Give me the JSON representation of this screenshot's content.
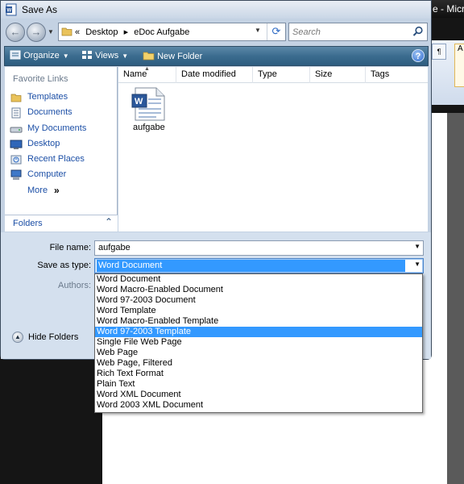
{
  "background_window": {
    "title_fragment": "e - Micro",
    "close_glyph": "X"
  },
  "dialog": {
    "title": "Save As"
  },
  "navigation": {
    "back_glyph": "←",
    "forward_glyph": "→",
    "address_prefix": "«",
    "breadcrumb": [
      "Desktop",
      "eDoc Aufgabe"
    ],
    "breadcrumb_separator": "▸",
    "search_placeholder": "Search"
  },
  "toolbar": {
    "organize_label": "Organize",
    "views_label": "Views",
    "new_folder_label": "New Folder",
    "help_glyph": "?"
  },
  "favorite_links": {
    "heading": "Favorite Links",
    "items": [
      {
        "label": "Templates",
        "icon": "folder-icon"
      },
      {
        "label": "Documents",
        "icon": "documents-icon"
      },
      {
        "label": "My Documents",
        "icon": "drive-icon"
      },
      {
        "label": "Desktop",
        "icon": "desktop-icon"
      },
      {
        "label": "Recent Places",
        "icon": "recent-places-icon"
      },
      {
        "label": "Computer",
        "icon": "computer-icon"
      },
      {
        "label": "More",
        "icon": "more-chevron-icon",
        "suffix": "»"
      }
    ],
    "folders_label": "Folders",
    "folders_chevron": "⌃"
  },
  "file_list": {
    "columns": [
      "Name",
      "Date modified",
      "Type",
      "Size",
      "Tags"
    ],
    "sort_arrow": "▲",
    "files": [
      {
        "name": "aufgabe",
        "icon": "word-document-icon"
      }
    ]
  },
  "form": {
    "file_name_label": "File name:",
    "file_name_value": "aufgabe",
    "save_as_type_label": "Save as type:",
    "save_as_type_value": "Word Document",
    "authors_label": "Authors:",
    "hide_folders_label": "Hide Folders"
  },
  "save_type_options": [
    "Word Document",
    "Word Macro-Enabled Document",
    "Word 97-2003 Document",
    "Word Template",
    "Word Macro-Enabled Template",
    "Word 97-2003 Template",
    "Single File Web Page",
    "Web Page",
    "Web Page, Filtered",
    "Rich Text Format",
    "Plain Text",
    "Word XML Document",
    "Word 2003 XML Document"
  ],
  "highlighted_option_index": 5,
  "colors": {
    "selection": "#3399ff",
    "link": "#1c4fa6",
    "toolbar": "#3b6c8f"
  }
}
